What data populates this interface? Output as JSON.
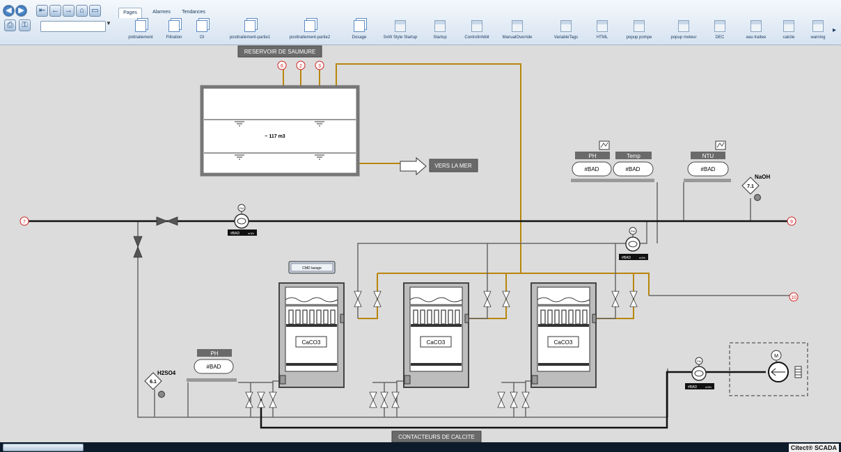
{
  "toolbar": {
    "tabs": [
      "Pages",
      "Alarmes",
      "Tendances"
    ],
    "pages": [
      {
        "label": "prétraitement",
        "icon": "page-icon"
      },
      {
        "label": "Filtration",
        "icon": "page-icon"
      },
      {
        "label": "OI",
        "icon": "page-icon"
      },
      {
        "label": "posttraitement-partie1",
        "icon": "page-icon"
      },
      {
        "label": "posttraitement-partie2",
        "icon": "page-icon"
      },
      {
        "label": "Dosage",
        "icon": "page-icon"
      },
      {
        "label": "SxW Style Startup",
        "icon": "screenshot-icon"
      },
      {
        "label": "Startup",
        "icon": "screenshot-icon"
      },
      {
        "label": "ControlInhibit",
        "icon": "screenshot-icon"
      },
      {
        "label": "ManualOverride",
        "icon": "screenshot-icon"
      },
      {
        "label": "VariableTags",
        "icon": "screenshot-icon"
      },
      {
        "label": "HTML",
        "icon": "screenshot-icon"
      },
      {
        "label": "popup pompe",
        "icon": "screenshot-icon"
      },
      {
        "label": "popup moteur",
        "icon": "screenshot-icon"
      },
      {
        "label": "DEC",
        "icon": "screenshot-icon"
      },
      {
        "label": "eau traitee",
        "icon": "screenshot-icon"
      },
      {
        "label": "calcite",
        "icon": "screenshot-icon"
      },
      {
        "label": "warning",
        "icon": "screenshot-icon"
      }
    ],
    "scroll_right_glyph": "▸",
    "dropdown_glyph": "▼"
  },
  "process": {
    "brine_tank_label": "RESERVOIR DE SAUMURE",
    "tank_volume": "~ 117 m3",
    "sea_outlet_label": "VERS LA MER",
    "tank_nozzles": [
      "6",
      "2",
      "3"
    ],
    "line_markers": {
      "inlet": "7",
      "outlet": "9",
      "secondary": "10"
    },
    "calcite_contactors_label": "CONTACTEURS DE CALCITE",
    "wash_command_label": "CMD lavage",
    "contactor_media": "CaCO3",
    "analyzers": [
      {
        "title": "PH",
        "value": "#BAD"
      },
      {
        "title": "Temp",
        "value": "#BAD"
      },
      {
        "title": "NTU",
        "value": "#BAD"
      },
      {
        "title": "PH",
        "value": "#BAD"
      }
    ],
    "dosing": [
      {
        "chemical": "NaOH",
        "tag": "7.1"
      },
      {
        "chemical": "H2SO4",
        "tag": "6.1"
      }
    ],
    "flowmeters": [
      {
        "symbol": "FM",
        "value": "#BAD",
        "unit": "m3/h"
      },
      {
        "symbol": "FM",
        "value": "#BAD",
        "unit": "m3/h"
      },
      {
        "symbol": "FM",
        "value": "#BAD",
        "unit": "m3/h"
      }
    ],
    "motor_symbol": "M",
    "colors": {
      "brine_pipe": "#b8860b",
      "process_pipe": "#6b6b6b",
      "main_pipe": "#111111",
      "marker_red": "#d02020",
      "label_bg": "#6a6a6a"
    }
  },
  "status": {
    "brand": "Citect® SCADA"
  }
}
